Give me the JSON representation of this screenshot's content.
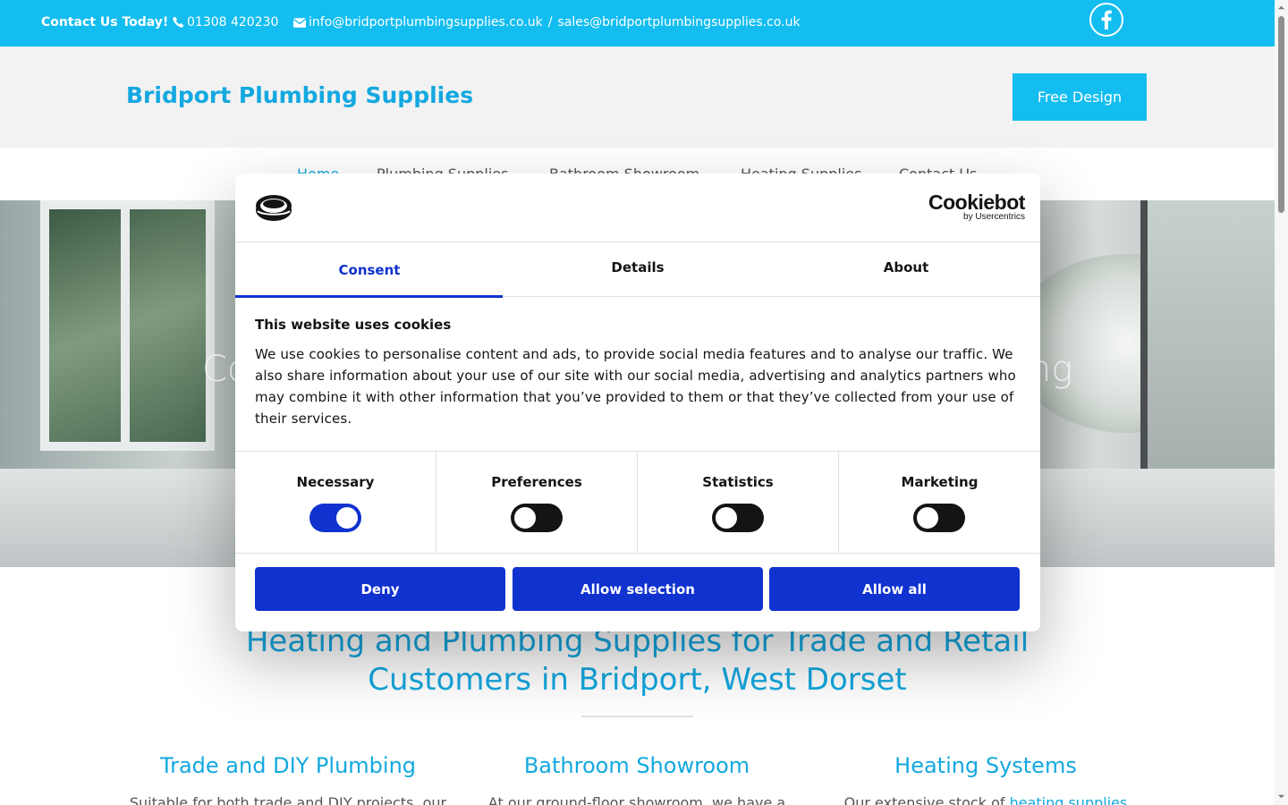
{
  "topbar": {
    "contact_label": "Contact Us Today!",
    "phone": "01308 420230",
    "email_info": "info@bridportplumbingsupplies.co.uk",
    "separator": "/",
    "email_sales": "sales@bridportplumbingsupplies.co.uk",
    "facebook_icon": "facebook-icon"
  },
  "header": {
    "brand": "Bridport Plumbing Supplies",
    "cta": "Free Design"
  },
  "nav": {
    "items": [
      "Home",
      "Plumbing Supplies",
      "Bathroom Showroom",
      "Heating Supplies",
      "Contact Us"
    ],
    "active": "Home"
  },
  "hero": {
    "text_left": "Co",
    "text_right": "ng"
  },
  "main": {
    "heading_line1": "Heating and Plumbing Supplies for Trade and Retail",
    "heading_line2": "Customers in Bridport, West Dorset",
    "columns": [
      {
        "title": "Trade and DIY Plumbing",
        "text": "Suitable for both trade and DIY projects, our"
      },
      {
        "title": "Bathroom Showroom",
        "text": "At our ground-floor showroom, we have a"
      },
      {
        "title": "Heating Systems",
        "text": "Our extensive stock of ",
        "link": "heating supplies"
      }
    ]
  },
  "cookie": {
    "brand_big": "Cookiebot",
    "brand_small": "by Usercentrics",
    "tabs": [
      "Consent",
      "Details",
      "About"
    ],
    "active_tab": "Consent",
    "title": "This website uses cookies",
    "text": "We use cookies to personalise content and ads, to provide social media features and to analyse our traffic. We also share information about your use of our site with our social media, advertising and analytics partners who may combine it with other information that you’ve provided to them or that they’ve collected from your use of their services.",
    "categories": [
      {
        "label": "Necessary",
        "enabled": true
      },
      {
        "label": "Preferences",
        "enabled": false
      },
      {
        "label": "Statistics",
        "enabled": false
      },
      {
        "label": "Marketing",
        "enabled": false
      }
    ],
    "buttons": {
      "deny": "Deny",
      "allow_selection": "Allow selection",
      "allow_all": "Allow all"
    },
    "accent_color": "#1032cf"
  },
  "colors": {
    "brand": "#13bdf0",
    "heading": "#13a8e0"
  }
}
